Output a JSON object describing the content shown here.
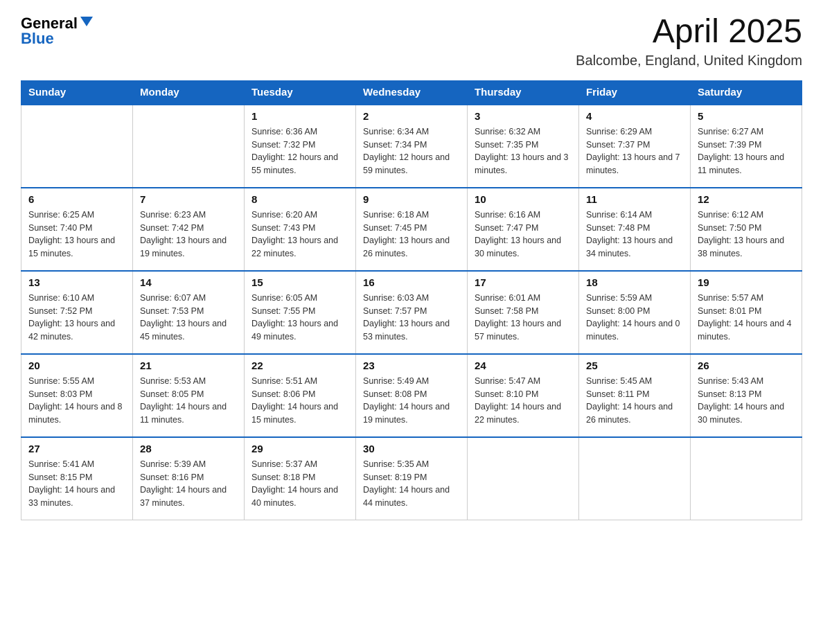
{
  "header": {
    "logo_general": "General",
    "logo_blue": "Blue",
    "title": "April 2025",
    "subtitle": "Balcombe, England, United Kingdom"
  },
  "days_of_week": [
    "Sunday",
    "Monday",
    "Tuesday",
    "Wednesday",
    "Thursday",
    "Friday",
    "Saturday"
  ],
  "weeks": [
    [
      {
        "day": "",
        "sunrise": "",
        "sunset": "",
        "daylight": ""
      },
      {
        "day": "",
        "sunrise": "",
        "sunset": "",
        "daylight": ""
      },
      {
        "day": "1",
        "sunrise": "Sunrise: 6:36 AM",
        "sunset": "Sunset: 7:32 PM",
        "daylight": "Daylight: 12 hours and 55 minutes."
      },
      {
        "day": "2",
        "sunrise": "Sunrise: 6:34 AM",
        "sunset": "Sunset: 7:34 PM",
        "daylight": "Daylight: 12 hours and 59 minutes."
      },
      {
        "day": "3",
        "sunrise": "Sunrise: 6:32 AM",
        "sunset": "Sunset: 7:35 PM",
        "daylight": "Daylight: 13 hours and 3 minutes."
      },
      {
        "day": "4",
        "sunrise": "Sunrise: 6:29 AM",
        "sunset": "Sunset: 7:37 PM",
        "daylight": "Daylight: 13 hours and 7 minutes."
      },
      {
        "day": "5",
        "sunrise": "Sunrise: 6:27 AM",
        "sunset": "Sunset: 7:39 PM",
        "daylight": "Daylight: 13 hours and 11 minutes."
      }
    ],
    [
      {
        "day": "6",
        "sunrise": "Sunrise: 6:25 AM",
        "sunset": "Sunset: 7:40 PM",
        "daylight": "Daylight: 13 hours and 15 minutes."
      },
      {
        "day": "7",
        "sunrise": "Sunrise: 6:23 AM",
        "sunset": "Sunset: 7:42 PM",
        "daylight": "Daylight: 13 hours and 19 minutes."
      },
      {
        "day": "8",
        "sunrise": "Sunrise: 6:20 AM",
        "sunset": "Sunset: 7:43 PM",
        "daylight": "Daylight: 13 hours and 22 minutes."
      },
      {
        "day": "9",
        "sunrise": "Sunrise: 6:18 AM",
        "sunset": "Sunset: 7:45 PM",
        "daylight": "Daylight: 13 hours and 26 minutes."
      },
      {
        "day": "10",
        "sunrise": "Sunrise: 6:16 AM",
        "sunset": "Sunset: 7:47 PM",
        "daylight": "Daylight: 13 hours and 30 minutes."
      },
      {
        "day": "11",
        "sunrise": "Sunrise: 6:14 AM",
        "sunset": "Sunset: 7:48 PM",
        "daylight": "Daylight: 13 hours and 34 minutes."
      },
      {
        "day": "12",
        "sunrise": "Sunrise: 6:12 AM",
        "sunset": "Sunset: 7:50 PM",
        "daylight": "Daylight: 13 hours and 38 minutes."
      }
    ],
    [
      {
        "day": "13",
        "sunrise": "Sunrise: 6:10 AM",
        "sunset": "Sunset: 7:52 PM",
        "daylight": "Daylight: 13 hours and 42 minutes."
      },
      {
        "day": "14",
        "sunrise": "Sunrise: 6:07 AM",
        "sunset": "Sunset: 7:53 PM",
        "daylight": "Daylight: 13 hours and 45 minutes."
      },
      {
        "day": "15",
        "sunrise": "Sunrise: 6:05 AM",
        "sunset": "Sunset: 7:55 PM",
        "daylight": "Daylight: 13 hours and 49 minutes."
      },
      {
        "day": "16",
        "sunrise": "Sunrise: 6:03 AM",
        "sunset": "Sunset: 7:57 PM",
        "daylight": "Daylight: 13 hours and 53 minutes."
      },
      {
        "day": "17",
        "sunrise": "Sunrise: 6:01 AM",
        "sunset": "Sunset: 7:58 PM",
        "daylight": "Daylight: 13 hours and 57 minutes."
      },
      {
        "day": "18",
        "sunrise": "Sunrise: 5:59 AM",
        "sunset": "Sunset: 8:00 PM",
        "daylight": "Daylight: 14 hours and 0 minutes."
      },
      {
        "day": "19",
        "sunrise": "Sunrise: 5:57 AM",
        "sunset": "Sunset: 8:01 PM",
        "daylight": "Daylight: 14 hours and 4 minutes."
      }
    ],
    [
      {
        "day": "20",
        "sunrise": "Sunrise: 5:55 AM",
        "sunset": "Sunset: 8:03 PM",
        "daylight": "Daylight: 14 hours and 8 minutes."
      },
      {
        "day": "21",
        "sunrise": "Sunrise: 5:53 AM",
        "sunset": "Sunset: 8:05 PM",
        "daylight": "Daylight: 14 hours and 11 minutes."
      },
      {
        "day": "22",
        "sunrise": "Sunrise: 5:51 AM",
        "sunset": "Sunset: 8:06 PM",
        "daylight": "Daylight: 14 hours and 15 minutes."
      },
      {
        "day": "23",
        "sunrise": "Sunrise: 5:49 AM",
        "sunset": "Sunset: 8:08 PM",
        "daylight": "Daylight: 14 hours and 19 minutes."
      },
      {
        "day": "24",
        "sunrise": "Sunrise: 5:47 AM",
        "sunset": "Sunset: 8:10 PM",
        "daylight": "Daylight: 14 hours and 22 minutes."
      },
      {
        "day": "25",
        "sunrise": "Sunrise: 5:45 AM",
        "sunset": "Sunset: 8:11 PM",
        "daylight": "Daylight: 14 hours and 26 minutes."
      },
      {
        "day": "26",
        "sunrise": "Sunrise: 5:43 AM",
        "sunset": "Sunset: 8:13 PM",
        "daylight": "Daylight: 14 hours and 30 minutes."
      }
    ],
    [
      {
        "day": "27",
        "sunrise": "Sunrise: 5:41 AM",
        "sunset": "Sunset: 8:15 PM",
        "daylight": "Daylight: 14 hours and 33 minutes."
      },
      {
        "day": "28",
        "sunrise": "Sunrise: 5:39 AM",
        "sunset": "Sunset: 8:16 PM",
        "daylight": "Daylight: 14 hours and 37 minutes."
      },
      {
        "day": "29",
        "sunrise": "Sunrise: 5:37 AM",
        "sunset": "Sunset: 8:18 PM",
        "daylight": "Daylight: 14 hours and 40 minutes."
      },
      {
        "day": "30",
        "sunrise": "Sunrise: 5:35 AM",
        "sunset": "Sunset: 8:19 PM",
        "daylight": "Daylight: 14 hours and 44 minutes."
      },
      {
        "day": "",
        "sunrise": "",
        "sunset": "",
        "daylight": ""
      },
      {
        "day": "",
        "sunrise": "",
        "sunset": "",
        "daylight": ""
      },
      {
        "day": "",
        "sunrise": "",
        "sunset": "",
        "daylight": ""
      }
    ]
  ]
}
